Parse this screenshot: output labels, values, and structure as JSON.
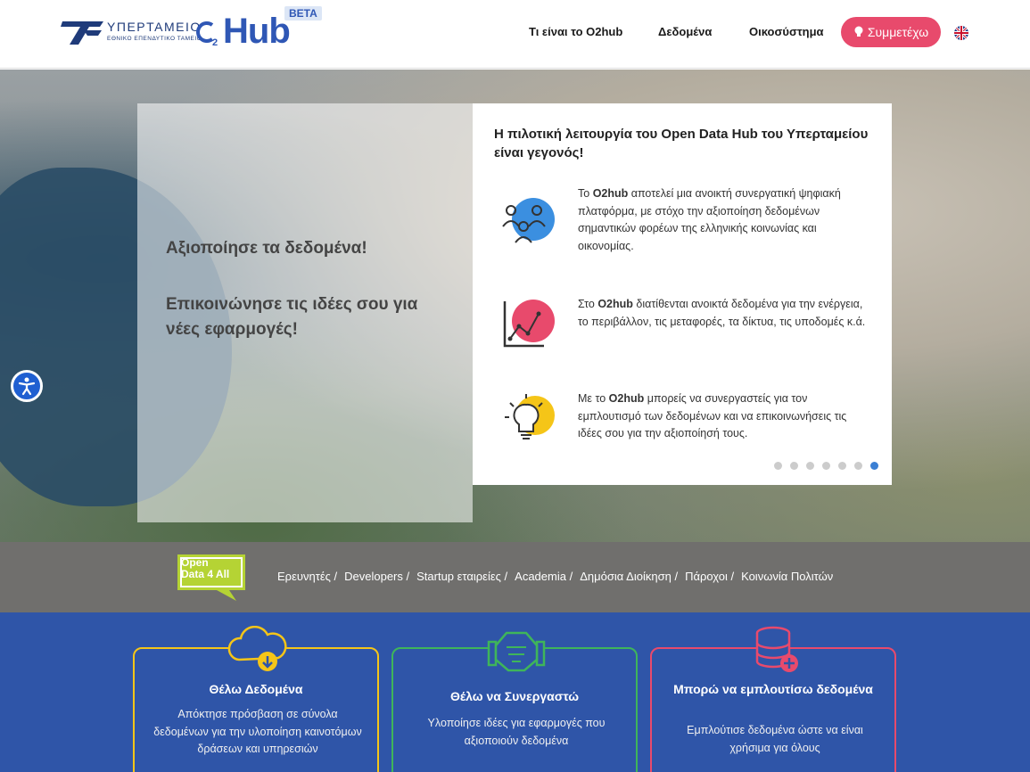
{
  "header": {
    "ministry_name": "ΥΠΕΡΤΑΜΕΙΟ",
    "ministry_sub": "ΕΘΝΙΚΟ ΕΠΕΝΔΥΤΙΚΟ ΤΑΜΕΙΟ",
    "brand": "Hub",
    "brand_prefix": "O",
    "brand_sub": "2",
    "beta": "BETA",
    "nav": [
      {
        "label": "Τι είναι το O2hub"
      },
      {
        "label": "Δεδομένα"
      },
      {
        "label": "Οικοσύστημα"
      }
    ],
    "join_label": "Συμμετέχω",
    "accent_color": "#e84a6c",
    "brand_color": "#2f57b5"
  },
  "hero": {
    "line1": "Αξιοποίησε τα δεδομένα!",
    "line2": "Επικοινώνησε τις ιδέες σου για νέες εφαρμογές!",
    "card": {
      "title": "Η πιλοτική λειτουργία του Open Data Hub του Υπερταμείου είναι γεγονός!",
      "features": [
        {
          "icon": "people-icon",
          "lead": "Το ",
          "bold": "O2hub",
          "text": " αποτελεί μια ανοικτή συνεργατική ψηφιακή πλατφόρμα, με στόχο την αξιοποίηση δεδομένων σημαντικών φορέων της ελληνικής κοινωνίας και οικονομίας."
        },
        {
          "icon": "chart-icon",
          "lead": "Στο ",
          "bold": "O2hub",
          "text": " διατίθενται ανοικτά δεδομένα για την ενέργεια, το περιβάλλον, τις μεταφορές, τα δίκτυα, τις υποδομές κ.ά."
        },
        {
          "icon": "lightbulb-icon",
          "lead": "Με το ",
          "bold": "O2hub",
          "text": " μπορείς να συνεργαστείς για τον εμπλουτισμό των δεδομένων και να επικοινωνήσεις τις ιδέες σου για την αξιοποίησή τους."
        }
      ],
      "slides_total": 7,
      "slide_active": 7
    }
  },
  "audience": {
    "badge_line1": "Open",
    "badge_line2": "Data 4 All",
    "items": [
      {
        "label": "Ερευνητές /"
      },
      {
        "label": "Developers /"
      },
      {
        "label": "Startup εταιρείες /"
      },
      {
        "label": "Academia /"
      },
      {
        "label": "Δημόσια Διοίκηση /"
      },
      {
        "label": "Πάροχοι /"
      },
      {
        "label": "Κοινωνία Πολιτών"
      }
    ]
  },
  "cta": [
    {
      "title": "Θέλω Δεδομένα",
      "desc": "Απόκτησε πρόσβαση σε σύνολα δεδομένων για την υλοποίηση καινοτόμων δράσεων και υπηρεσιών",
      "color": "#f5c518",
      "icon": "cloud-download-icon"
    },
    {
      "title": "Θέλω να Συνεργαστώ",
      "desc": "Υλοποίησε ιδέες για εφαρμογές που αξιοποιούν δεδομένα",
      "color": "#3fb55a",
      "icon": "handshake-icon"
    },
    {
      "title": "Μπορώ να εμπλουτίσω δεδομένα",
      "desc": "Εμπλούτισε δεδομένα ώστε να είναι χρήσιμα για όλους",
      "color": "#e84a6c",
      "icon": "database-add-icon"
    }
  ]
}
